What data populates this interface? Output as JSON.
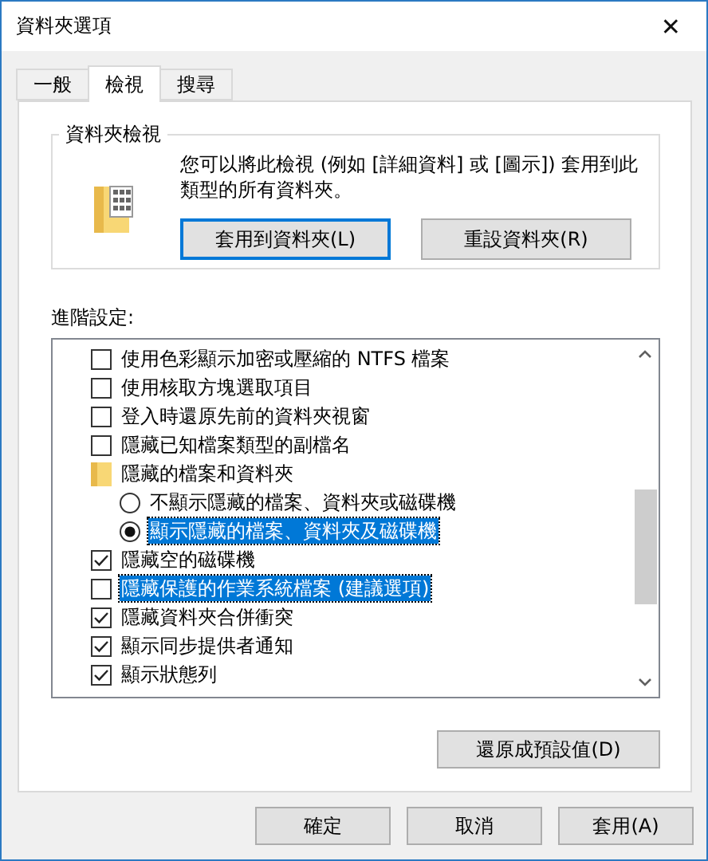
{
  "window": {
    "title": "資料夾選項",
    "close": "✕"
  },
  "tabs": [
    {
      "label": "一般",
      "selected": false
    },
    {
      "label": "檢視",
      "selected": true
    },
    {
      "label": "搜尋",
      "selected": false
    }
  ],
  "folder_views": {
    "title": "資料夾檢視",
    "description": "您可以將此檢視 (例如 [詳細資料] 或 [圖示]) 套用到此類型的所有資料夾。",
    "buttons": [
      {
        "label": "套用到資料夾(L)",
        "default": true
      },
      {
        "label": "重設資料夾(R)",
        "default": false
      }
    ]
  },
  "advanced": {
    "label": "進階設定:",
    "items": [
      {
        "kind": "checkbox",
        "label": "使用色彩顯示加密或壓縮的 NTFS 檔案",
        "checked": false,
        "selected": false
      },
      {
        "kind": "checkbox",
        "label": "使用核取方塊選取項目",
        "checked": false,
        "selected": false
      },
      {
        "kind": "checkbox",
        "label": "登入時還原先前的資料夾視窗",
        "checked": false,
        "selected": false
      },
      {
        "kind": "checkbox",
        "label": "隱藏已知檔案類型的副檔名",
        "checked": false,
        "selected": false
      },
      {
        "kind": "folder",
        "label": "隱藏的檔案和資料夾",
        "selected": false,
        "children": [
          {
            "kind": "radio",
            "label": "不顯示隱藏的檔案、資料夾或磁碟機",
            "checked": false,
            "selected": false
          },
          {
            "kind": "radio",
            "label": "顯示隱藏的檔案、資料夾及磁碟機",
            "checked": true,
            "selected": true
          }
        ]
      },
      {
        "kind": "checkbox",
        "label": "隱藏空的磁碟機",
        "checked": true,
        "selected": false
      },
      {
        "kind": "checkbox",
        "label": "隱藏保護的作業系統檔案 (建議選項)",
        "checked": false,
        "selected": true
      },
      {
        "kind": "checkbox",
        "label": "隱藏資料夾合併衝突",
        "checked": true,
        "selected": false
      },
      {
        "kind": "checkbox",
        "label": "顯示同步提供者通知",
        "checked": true,
        "selected": false
      },
      {
        "kind": "checkbox",
        "label": "顯示狀態列",
        "checked": true,
        "selected": false
      }
    ],
    "restore_button": "還原成預設值(D)"
  },
  "buttons": [
    "確定",
    "取消",
    "套用(A)"
  ]
}
